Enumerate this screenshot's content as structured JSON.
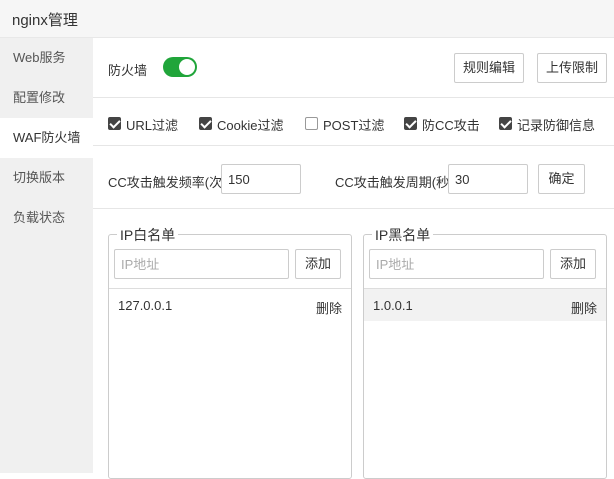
{
  "window": {
    "title": "nginx管理"
  },
  "sidebar": {
    "items": [
      {
        "label": "Web服务"
      },
      {
        "label": "配置修改"
      },
      {
        "label": "WAF防火墙"
      },
      {
        "label": "切换版本"
      },
      {
        "label": "负载状态"
      }
    ],
    "active_index": 2
  },
  "firewall": {
    "label": "防火墙",
    "enabled": true,
    "toggle_color": "#20a53a"
  },
  "toolbar": {
    "rules_edit_label": "规则编辑",
    "upload_limit_label": "上传限制"
  },
  "filters": [
    {
      "label": "URL过滤",
      "checked": true
    },
    {
      "label": "Cookie过滤",
      "checked": true
    },
    {
      "label": "POST过滤",
      "checked": false
    },
    {
      "label": "防CC攻击",
      "checked": true
    },
    {
      "label": "记录防御信息",
      "checked": true
    }
  ],
  "cc": {
    "freq_label": "CC攻击触发频率(次)",
    "freq_value": "150",
    "period_label": "CC攻击触发周期(秒)",
    "period_value": "30",
    "confirm_label": "确定"
  },
  "whitelist": {
    "title": "IP白名单",
    "placeholder": "IP地址",
    "add_label": "添加",
    "entries": [
      {
        "ip": "127.0.0.1",
        "delete_label": "删除"
      }
    ]
  },
  "blacklist": {
    "title": "IP黑名单",
    "placeholder": "IP地址",
    "add_label": "添加",
    "entries": [
      {
        "ip": "1.0.0.1",
        "delete_label": "删除"
      }
    ]
  }
}
